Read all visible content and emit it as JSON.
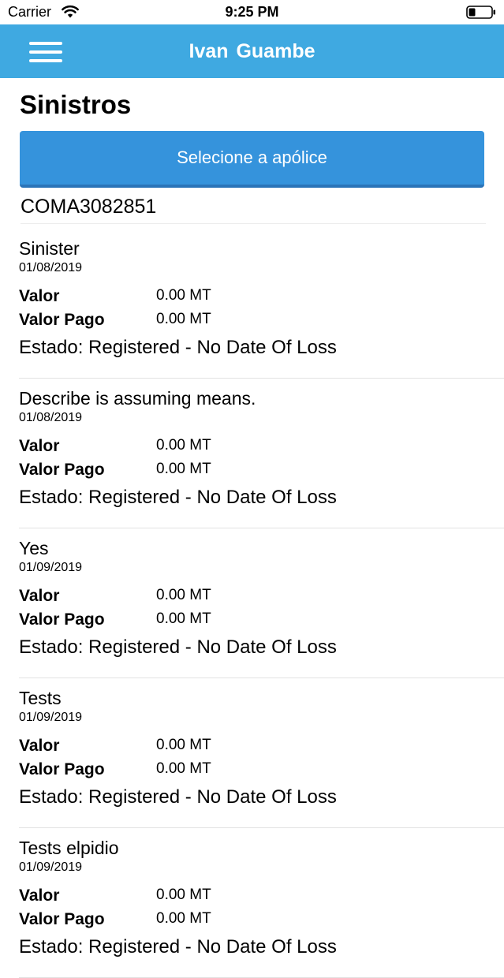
{
  "status_bar": {
    "carrier": "Carrier",
    "time": "9:25 PM",
    "icons": [
      "wifi-icon",
      "battery-icon"
    ]
  },
  "nav": {
    "title": "Ivan  Guambe",
    "menu_icon": "hamburger-menu-icon",
    "background_color": "#3fa9e1"
  },
  "page": {
    "title": "Sinistros",
    "select_policy_label": "Selecione a apólice",
    "button_color": "#3593dc",
    "policy_number": "COMA3082851"
  },
  "labels": {
    "valor": "Valor",
    "valor_pago": "Valor Pago"
  },
  "claims": [
    {
      "title": "Sinister",
      "date": "01/08/2019",
      "valor": "0.00 MT",
      "valor_pago": "0.00 MT",
      "status": "Estado: Registered - No Date Of Loss"
    },
    {
      "title": "Describe is assuming means.",
      "date": "01/08/2019",
      "valor": "0.00 MT",
      "valor_pago": "0.00 MT",
      "status": "Estado: Registered - No Date Of Loss"
    },
    {
      "title": "Yes",
      "date": "01/09/2019",
      "valor": "0.00 MT",
      "valor_pago": "0.00 MT",
      "status": "Estado: Registered - No Date Of Loss"
    },
    {
      "title": "Tests",
      "date": "01/09/2019",
      "valor": "0.00 MT",
      "valor_pago": "0.00 MT",
      "status": "Estado: Registered - No Date Of Loss"
    },
    {
      "title": "Tests elpidio",
      "date": "01/09/2019",
      "valor": "0.00 MT",
      "valor_pago": "0.00 MT",
      "status": "Estado: Registered - No Date Of Loss"
    }
  ]
}
